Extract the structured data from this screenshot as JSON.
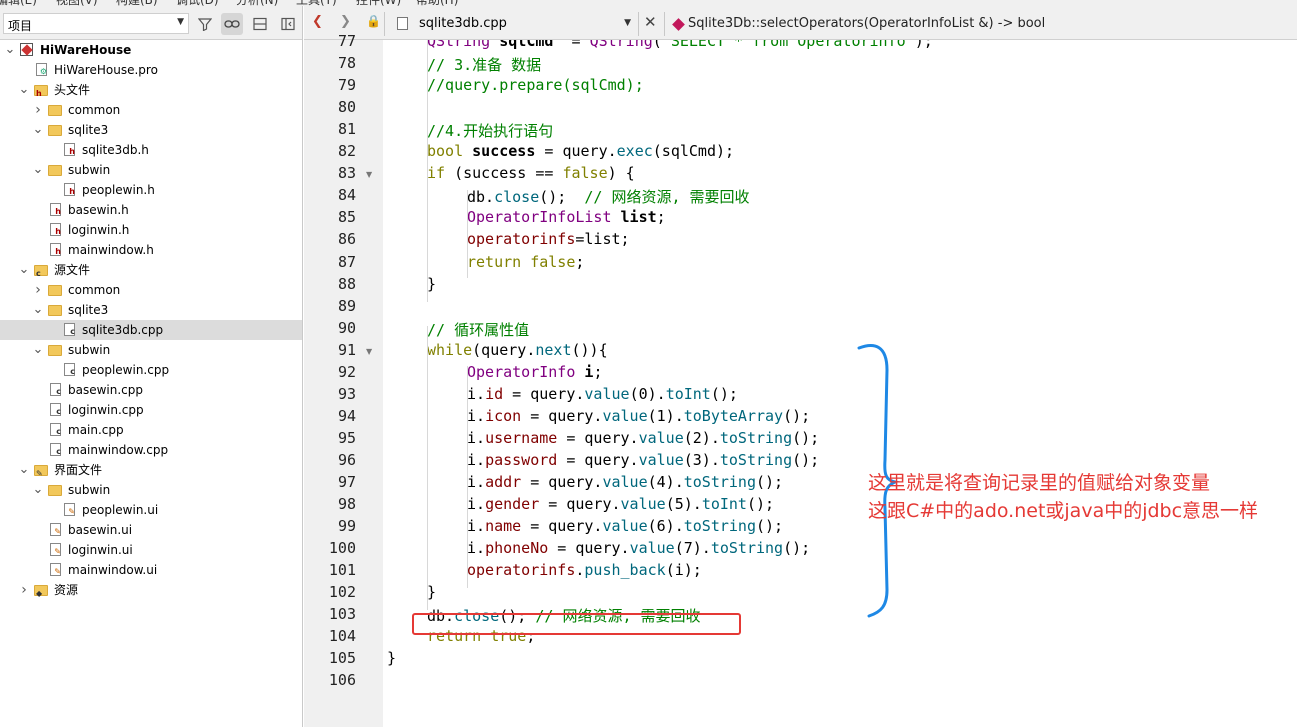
{
  "menubar": [
    "编辑(E)",
    "视图(V)",
    "构建(B)",
    "调试(D)",
    "分析(N)",
    "工具(T)",
    "控件(W)",
    "帮助(H)"
  ],
  "project_panel": {
    "selector_label": "项目",
    "tree": [
      {
        "label": "HiWareHouse",
        "depth": 0,
        "expanded": true,
        "kind": "project",
        "bold": true
      },
      {
        "label": "HiWareHouse.pro",
        "depth": 1,
        "kind": "pro"
      },
      {
        "label": "头文件",
        "depth": 1,
        "expanded": true,
        "kind": "folder-h"
      },
      {
        "label": "common",
        "depth": 2,
        "expanded": false,
        "kind": "folder"
      },
      {
        "label": "sqlite3",
        "depth": 2,
        "expanded": true,
        "kind": "folder"
      },
      {
        "label": "sqlite3db.h",
        "depth": 3,
        "kind": "h"
      },
      {
        "label": "subwin",
        "depth": 2,
        "expanded": true,
        "kind": "folder"
      },
      {
        "label": "peoplewin.h",
        "depth": 3,
        "kind": "h"
      },
      {
        "label": "basewin.h",
        "depth": 2,
        "kind": "h"
      },
      {
        "label": "loginwin.h",
        "depth": 2,
        "kind": "h"
      },
      {
        "label": "mainwindow.h",
        "depth": 2,
        "kind": "h"
      },
      {
        "label": "源文件",
        "depth": 1,
        "expanded": true,
        "kind": "folder-cpp"
      },
      {
        "label": "common",
        "depth": 2,
        "expanded": false,
        "kind": "folder"
      },
      {
        "label": "sqlite3",
        "depth": 2,
        "expanded": true,
        "kind": "folder"
      },
      {
        "label": "sqlite3db.cpp",
        "depth": 3,
        "kind": "cpp",
        "selected": true
      },
      {
        "label": "subwin",
        "depth": 2,
        "expanded": true,
        "kind": "folder"
      },
      {
        "label": "peoplewin.cpp",
        "depth": 3,
        "kind": "cpp"
      },
      {
        "label": "basewin.cpp",
        "depth": 2,
        "kind": "cpp"
      },
      {
        "label": "loginwin.cpp",
        "depth": 2,
        "kind": "cpp"
      },
      {
        "label": "main.cpp",
        "depth": 2,
        "kind": "cpp"
      },
      {
        "label": "mainwindow.cpp",
        "depth": 2,
        "kind": "cpp"
      },
      {
        "label": "界面文件",
        "depth": 1,
        "expanded": true,
        "kind": "folder-ui"
      },
      {
        "label": "subwin",
        "depth": 2,
        "expanded": true,
        "kind": "folder"
      },
      {
        "label": "peoplewin.ui",
        "depth": 3,
        "kind": "ui"
      },
      {
        "label": "basewin.ui",
        "depth": 2,
        "kind": "ui"
      },
      {
        "label": "loginwin.ui",
        "depth": 2,
        "kind": "ui"
      },
      {
        "label": "mainwindow.ui",
        "depth": 2,
        "kind": "ui"
      },
      {
        "label": "资源",
        "depth": 1,
        "expanded": false,
        "kind": "folder-res"
      }
    ]
  },
  "editor": {
    "open_file": "sqlite3db.cpp",
    "current_symbol": "Sqlite3Db::selectOperators(OperatorInfoList &) -> bool",
    "foldable_lines": [
      83,
      91
    ],
    "lines": [
      {
        "n": "77",
        "indent": 1,
        "tokens": [
          [
            "ty",
            "QString "
          ],
          [
            "bd",
            "sqlCmd"
          ],
          [
            "",
            "  = "
          ],
          [
            "ty",
            "QString"
          ],
          [
            "",
            "("
          ],
          [
            "str",
            "\"SELECT * from Operatorinfo\""
          ],
          [
            "",
            ");"
          ]
        ]
      },
      {
        "n": "78",
        "indent": 1,
        "tokens": [
          [
            "cm",
            "// 3.准备 数据"
          ]
        ]
      },
      {
        "n": "79",
        "indent": 1,
        "tokens": [
          [
            "cm",
            "//query.prepare(sqlCmd);"
          ]
        ]
      },
      {
        "n": "80",
        "indent": 0,
        "tokens": []
      },
      {
        "n": "81",
        "indent": 1,
        "tokens": [
          [
            "cm",
            "//4.开始执行语句"
          ]
        ]
      },
      {
        "n": "82",
        "indent": 1,
        "tokens": [
          [
            "kw",
            "bool "
          ],
          [
            "bd",
            "success"
          ],
          [
            "",
            " = query."
          ],
          [
            "fn",
            "exec"
          ],
          [
            "",
            "(sqlCmd);"
          ]
        ]
      },
      {
        "n": "83",
        "indent": 1,
        "tokens": [
          [
            "kw",
            "if"
          ],
          [
            "",
            " (success == "
          ],
          [
            "kw",
            "false"
          ],
          [
            "",
            ") {"
          ]
        ]
      },
      {
        "n": "84",
        "indent": 2,
        "tokens": [
          [
            "",
            "db."
          ],
          [
            "fn",
            "close"
          ],
          [
            "",
            "();  "
          ],
          [
            "cm",
            "// 网络资源, 需要回收"
          ]
        ]
      },
      {
        "n": "85",
        "indent": 2,
        "tokens": [
          [
            "ty",
            "OperatorInfoList "
          ],
          [
            "bd",
            "list"
          ],
          [
            "",
            ";"
          ]
        ]
      },
      {
        "n": "86",
        "indent": 2,
        "tokens": [
          [
            "mb",
            "operatorinfs"
          ],
          [
            "",
            "=list;"
          ]
        ]
      },
      {
        "n": "87",
        "indent": 2,
        "tokens": [
          [
            "kw",
            "return false"
          ],
          [
            "",
            ";"
          ]
        ]
      },
      {
        "n": "88",
        "indent": 1,
        "tokens": [
          [
            "",
            "}"
          ]
        ]
      },
      {
        "n": "89",
        "indent": 0,
        "tokens": []
      },
      {
        "n": "90",
        "indent": 1,
        "tokens": [
          [
            "cm",
            "// 循环属性值"
          ]
        ]
      },
      {
        "n": "91",
        "indent": 1,
        "tokens": [
          [
            "kw",
            "while"
          ],
          [
            "",
            "(query."
          ],
          [
            "fn",
            "next"
          ],
          [
            "",
            "()){"
          ]
        ]
      },
      {
        "n": "92",
        "indent": 2,
        "tokens": [
          [
            "ty",
            "OperatorInfo "
          ],
          [
            "bd",
            "i"
          ],
          [
            "",
            ";"
          ]
        ]
      },
      {
        "n": "93",
        "indent": 2,
        "tokens": [
          [
            "",
            "i."
          ],
          [
            "mb",
            "id"
          ],
          [
            "",
            " = query."
          ],
          [
            "fn",
            "value"
          ],
          [
            "",
            "(0)."
          ],
          [
            "fn",
            "toInt"
          ],
          [
            "",
            "();"
          ]
        ]
      },
      {
        "n": "94",
        "indent": 2,
        "tokens": [
          [
            "",
            "i."
          ],
          [
            "mb",
            "icon"
          ],
          [
            "",
            " = query."
          ],
          [
            "fn",
            "value"
          ],
          [
            "",
            "(1)."
          ],
          [
            "fn",
            "toByteArray"
          ],
          [
            "",
            "();"
          ]
        ]
      },
      {
        "n": "95",
        "indent": 2,
        "tokens": [
          [
            "",
            "i."
          ],
          [
            "mb",
            "username"
          ],
          [
            "",
            " = query."
          ],
          [
            "fn",
            "value"
          ],
          [
            "",
            "(2)."
          ],
          [
            "fn",
            "toString"
          ],
          [
            "",
            "();"
          ]
        ]
      },
      {
        "n": "96",
        "indent": 2,
        "tokens": [
          [
            "",
            "i."
          ],
          [
            "mb",
            "password"
          ],
          [
            "",
            " = query."
          ],
          [
            "fn",
            "value"
          ],
          [
            "",
            "(3)."
          ],
          [
            "fn",
            "toString"
          ],
          [
            "",
            "();"
          ]
        ]
      },
      {
        "n": "97",
        "indent": 2,
        "tokens": [
          [
            "",
            "i."
          ],
          [
            "mb",
            "addr"
          ],
          [
            "",
            " = query."
          ],
          [
            "fn",
            "value"
          ],
          [
            "",
            "(4)."
          ],
          [
            "fn",
            "toString"
          ],
          [
            "",
            "();"
          ]
        ]
      },
      {
        "n": "98",
        "indent": 2,
        "tokens": [
          [
            "",
            "i."
          ],
          [
            "mb",
            "gender"
          ],
          [
            "",
            " = query."
          ],
          [
            "fn",
            "value"
          ],
          [
            "",
            "(5)."
          ],
          [
            "fn",
            "toInt"
          ],
          [
            "",
            "();"
          ]
        ]
      },
      {
        "n": "99",
        "indent": 2,
        "tokens": [
          [
            "",
            "i."
          ],
          [
            "mb",
            "name"
          ],
          [
            "",
            " = query."
          ],
          [
            "fn",
            "value"
          ],
          [
            "",
            "(6)."
          ],
          [
            "fn",
            "toString"
          ],
          [
            "",
            "();"
          ]
        ]
      },
      {
        "n": "100",
        "indent": 2,
        "tokens": [
          [
            "",
            "i."
          ],
          [
            "mb",
            "phoneNo"
          ],
          [
            "",
            " = query."
          ],
          [
            "fn",
            "value"
          ],
          [
            "",
            "(7)."
          ],
          [
            "fn",
            "toString"
          ],
          [
            "",
            "();"
          ]
        ]
      },
      {
        "n": "101",
        "indent": 2,
        "tokens": [
          [
            "mb",
            "operatorinfs"
          ],
          [
            "",
            "."
          ],
          [
            "fn",
            "push_back"
          ],
          [
            "",
            "(i);"
          ]
        ]
      },
      {
        "n": "102",
        "indent": 1,
        "tokens": [
          [
            "",
            "}"
          ]
        ]
      },
      {
        "n": "103",
        "indent": 1,
        "tokens": [
          [
            "",
            "db."
          ],
          [
            "fn",
            "close"
          ],
          [
            "",
            "(); "
          ],
          [
            "cm",
            "// 网络资源, 需要回收"
          ]
        ]
      },
      {
        "n": "104",
        "indent": 1,
        "tokens": [
          [
            "kw",
            "return true"
          ],
          [
            "",
            ";"
          ]
        ]
      },
      {
        "n": "105",
        "indent": 0,
        "tokens": [
          [
            "",
            "}"
          ]
        ]
      },
      {
        "n": "106",
        "indent": 0,
        "tokens": []
      }
    ]
  },
  "annotation": {
    "line1": "这里就是将查询记录里的值赋给对象变量",
    "line2": "这跟C#中的ado.net或java中的jdbc意思一样",
    "color": "#e53935",
    "brace_color": "#1e88e5"
  }
}
